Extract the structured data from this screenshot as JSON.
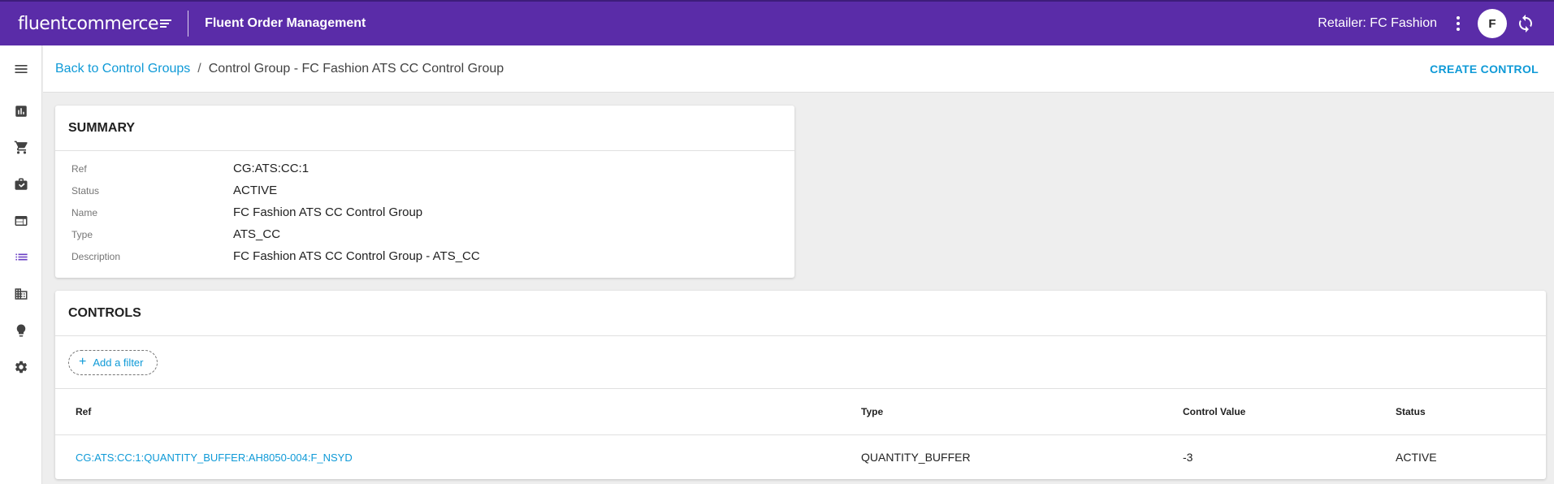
{
  "topbar": {
    "logo_text": "fluentcommerce",
    "app_title": "Fluent Order Management",
    "retailer": "Retailer: FC Fashion",
    "avatar_initial": "F"
  },
  "sidebar": {
    "items": [
      {
        "icon": "menu-icon"
      },
      {
        "icon": "bar-chart-icon"
      },
      {
        "icon": "shopping-cart-icon"
      },
      {
        "icon": "briefcase-icon"
      },
      {
        "icon": "web-window-icon"
      },
      {
        "icon": "list-icon",
        "active": true
      },
      {
        "icon": "building-icon"
      },
      {
        "icon": "lightbulb-icon"
      },
      {
        "icon": "gear-icon"
      }
    ]
  },
  "header": {
    "back_link": "Back to Control Groups",
    "separator": "/",
    "current": "Control Group - FC Fashion ATS CC Control Group",
    "create_button": "CREATE CONTROL"
  },
  "summary": {
    "title": "SUMMARY",
    "rows": [
      {
        "label": "Ref",
        "value": "CG:ATS:CC:1"
      },
      {
        "label": "Status",
        "value": "ACTIVE"
      },
      {
        "label": "Name",
        "value": "FC Fashion ATS CC Control Group"
      },
      {
        "label": "Type",
        "value": "ATS_CC"
      },
      {
        "label": "Description",
        "value": "FC Fashion ATS CC Control Group - ATS_CC"
      }
    ]
  },
  "controls": {
    "title": "CONTROLS",
    "filter_button": "Add a filter",
    "columns": [
      "Ref",
      "Type",
      "Control Value",
      "Status"
    ],
    "rows": [
      {
        "ref": "CG:ATS:CC:1:QUANTITY_BUFFER:AH8050-004:F_NSYD",
        "type": "QUANTITY_BUFFER",
        "control_value": "-3",
        "status": "ACTIVE"
      }
    ]
  },
  "colors": {
    "topbar": "#5a2ca8",
    "link": "#0f9ad7",
    "active_icon": "#6a3fc4"
  }
}
